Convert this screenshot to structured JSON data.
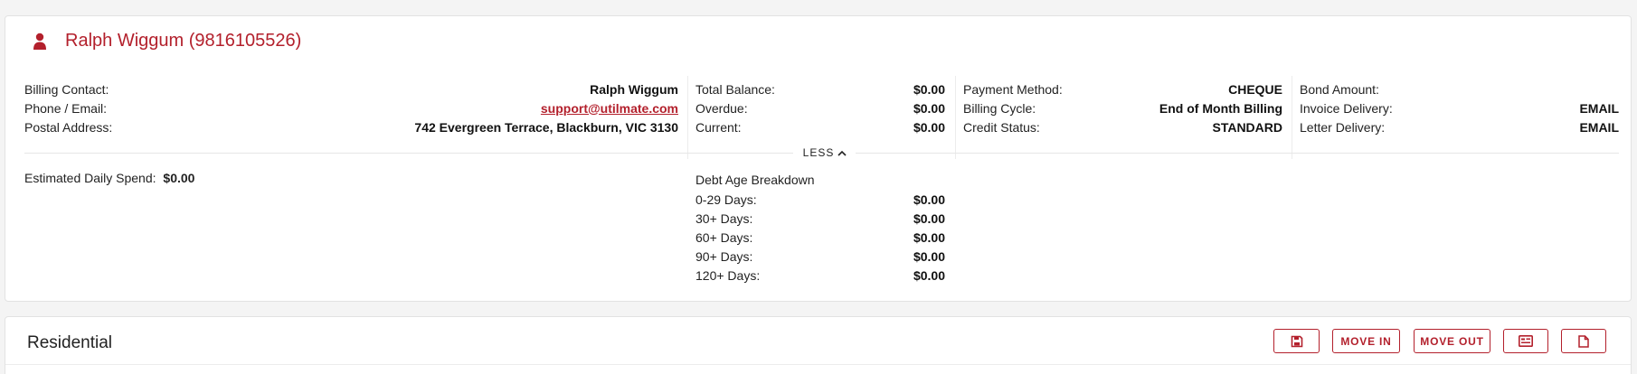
{
  "colors": {
    "accent": "#b3202c"
  },
  "account": {
    "icon": "person-icon",
    "name": "Ralph Wiggum (9816105526)",
    "contact": [
      {
        "label": "Billing Contact:",
        "value": "Ralph Wiggum"
      },
      {
        "label": "Phone / Email:",
        "value": "support@utilmate.com"
      },
      {
        "label": "Postal Address:",
        "value": "742 Evergreen Terrace, Blackburn, VIC 3130"
      }
    ],
    "balance": [
      {
        "label": "Total Balance:",
        "value": "$0.00"
      },
      {
        "label": "Overdue:",
        "value": "$0.00"
      },
      {
        "label": "Current:",
        "value": "$0.00"
      }
    ],
    "billing": [
      {
        "label": "Payment Method:",
        "value": "CHEQUE"
      },
      {
        "label": "Billing Cycle:",
        "value": "End of Month Billing"
      },
      {
        "label": "Credit Status:",
        "value": "STANDARD"
      }
    ],
    "delivery": [
      {
        "label": "Bond Amount:",
        "value": ""
      },
      {
        "label": "Invoice Delivery:",
        "value": "EMAIL"
      },
      {
        "label": "Letter Delivery:",
        "value": "EMAIL"
      }
    ],
    "toggle_label": "LESS",
    "toggle_icon": "chevron-up-icon",
    "daily_spend": {
      "label": "Estimated Daily Spend:",
      "value": "$0.00"
    },
    "debt": {
      "title": "Debt Age Breakdown",
      "rows": [
        {
          "label": "0-29 Days:",
          "value": "$0.00"
        },
        {
          "label": "30+ Days:",
          "value": "$0.00"
        },
        {
          "label": "60+ Days:",
          "value": "$0.00"
        },
        {
          "label": "90+ Days:",
          "value": "$0.00"
        },
        {
          "label": "120+ Days:",
          "value": "$0.00"
        }
      ]
    }
  },
  "residential": {
    "title": "Residential",
    "buttons": {
      "save_icon": "save-icon",
      "move_in": "MOVE IN",
      "move_out": "MOVE OUT",
      "card_icon": "id-card-icon",
      "document_icon": "document-icon"
    }
  }
}
